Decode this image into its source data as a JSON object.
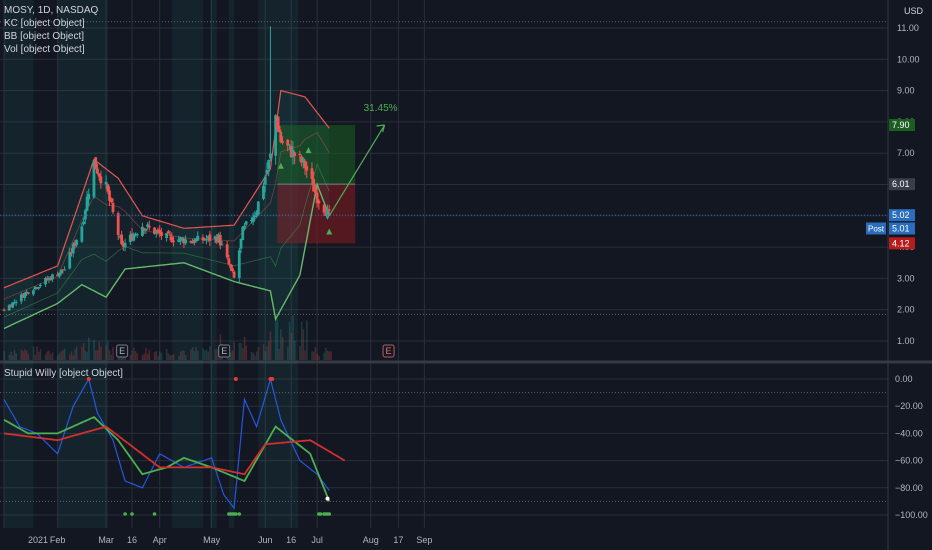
{
  "header": {
    "symbol_line": "MOSY, 1D, NASDAQ",
    "currency": "USD"
  },
  "legend": {
    "kc": "KC [object Object]",
    "bb": "BB [object Object]",
    "vol": "Vol [object Object]",
    "oscillator": "Stupid Willy [object Object]"
  },
  "colors": {
    "background": "#131722",
    "grid": "#2a2e39",
    "up": "#26a69a",
    "down": "#ef5350",
    "kc_band": "#ef5350",
    "bb_band": "#4caf50",
    "long_target": "#1b5e20",
    "long_stop": "#801922",
    "signal_red": "#d32f2f",
    "signal_green": "#4caf50",
    "osc_blue": "#2962ff",
    "accent_teal": "#26a69a"
  },
  "position_tool": {
    "percent_label": "31.45%",
    "target": 7.9,
    "entry": 6.01,
    "stop": 4.12
  },
  "price_tags": [
    {
      "value": 7.9,
      "text": "7.90",
      "color": "#1b5e20"
    },
    {
      "value": 6.01,
      "text": "6.01",
      "color": "#3a3e4a"
    },
    {
      "value": 5.02,
      "text": "5.02",
      "color": "#2a6dbd"
    },
    {
      "value": 5.01,
      "text": "Post · 5.01",
      "color": "#2a6dbd"
    },
    {
      "value": 4.12,
      "text": "4.12",
      "color": "#b71c1c"
    }
  ],
  "earnings_markers": [
    "E",
    "E",
    "E"
  ],
  "chart_data": [
    {
      "type": "candlestick",
      "title": "MOSY, 1D, NASDAQ",
      "y_axis": {
        "ticks": [
          1.0,
          2.0,
          3.0,
          4.0,
          5.0,
          6.0,
          7.0,
          8.0,
          9.0,
          10.0,
          11.0
        ],
        "labels": [
          "1.00",
          "2.00",
          "3.00",
          "4.00",
          "5.00",
          "6.00",
          "7.00",
          "8.00",
          "9.00",
          "10.00",
          "11.00"
        ],
        "ylim": [
          0.5,
          11.6
        ],
        "currency": "USD"
      },
      "x_axis": {
        "labels": [
          "2021",
          "Feb",
          "Mar",
          "16",
          "Apr",
          "May",
          "Jun",
          "16",
          "Jul",
          "Aug",
          "17",
          "Sep"
        ]
      },
      "close_anchors": [
        {
          "date": "2021-01-01",
          "price": 2.0
        },
        {
          "date": "2021-01-15",
          "price": 2.6
        },
        {
          "date": "2021-02-05",
          "price": 3.3
        },
        {
          "date": "2021-02-15",
          "price": 4.7
        },
        {
          "date": "2021-02-22",
          "price": 6.7
        },
        {
          "date": "2021-03-01",
          "price": 5.9
        },
        {
          "date": "2021-03-10",
          "price": 4.0
        },
        {
          "date": "2021-03-22",
          "price": 4.7
        },
        {
          "date": "2021-04-05",
          "price": 4.3
        },
        {
          "date": "2021-04-20",
          "price": 4.2
        },
        {
          "date": "2021-05-05",
          "price": 4.3
        },
        {
          "date": "2021-05-14",
          "price": 3.0
        },
        {
          "date": "2021-05-19",
          "price": 4.5
        },
        {
          "date": "2021-05-27",
          "price": 5.2
        },
        {
          "date": "2021-06-04",
          "price": 6.9
        },
        {
          "date": "2021-06-07",
          "price": 8.2
        },
        {
          "date": "2021-06-10",
          "price": 7.4
        },
        {
          "date": "2021-06-17",
          "price": 7.0
        },
        {
          "date": "2021-06-24",
          "price": 6.6
        },
        {
          "date": "2021-07-01",
          "price": 5.6
        },
        {
          "date": "2021-07-08",
          "price": 5.0
        }
      ],
      "spike_high": {
        "date": "2021-06-04",
        "price": 10.8
      },
      "bb_lower": [
        {
          "date": "2021-01-01",
          "price": 1.4
        },
        {
          "date": "2021-02-01",
          "price": 2.2
        },
        {
          "date": "2021-02-15",
          "price": 2.8
        },
        {
          "date": "2021-03-01",
          "price": 2.4
        },
        {
          "date": "2021-03-12",
          "price": 3.3
        },
        {
          "date": "2021-04-15",
          "price": 3.5
        },
        {
          "date": "2021-05-14",
          "price": 2.9
        },
        {
          "date": "2021-06-04",
          "price": 2.6
        },
        {
          "date": "2021-06-07",
          "price": 1.7
        },
        {
          "date": "2021-06-21",
          "price": 3.1
        },
        {
          "date": "2021-07-01",
          "price": 6.0
        },
        {
          "date": "2021-07-08",
          "price": 5.0
        }
      ],
      "kc_upper": [
        {
          "date": "2021-01-01",
          "price": 2.7
        },
        {
          "date": "2021-02-01",
          "price": 3.4
        },
        {
          "date": "2021-02-22",
          "price": 6.8
        },
        {
          "date": "2021-03-08",
          "price": 6.2
        },
        {
          "date": "2021-03-22",
          "price": 5.0
        },
        {
          "date": "2021-04-15",
          "price": 4.6
        },
        {
          "date": "2021-05-14",
          "price": 4.7
        },
        {
          "date": "2021-06-04",
          "price": 6.5
        },
        {
          "date": "2021-06-10",
          "price": 9.0
        },
        {
          "date": "2021-06-24",
          "price": 8.8
        },
        {
          "date": "2021-07-08",
          "price": 7.8
        }
      ],
      "position": {
        "start": "2021-06-08",
        "end": "2021-07-23",
        "target": 7.9,
        "entry": 6.01,
        "stop": 4.12,
        "arrow_to": {
          "date": "2021-08-09",
          "price": 7.9
        }
      }
    },
    {
      "type": "line",
      "title": "Stupid Willy [object Object]",
      "y_axis": {
        "ticks": [
          0,
          -20,
          -40,
          -60,
          -80,
          -100
        ],
        "labels": [
          "0.00",
          "−20.00",
          "−40.00",
          "−60.00",
          "−80.00",
          "−100.00"
        ],
        "ylim": [
          -105,
          3
        ]
      },
      "series": [
        {
          "color": "#2962ff",
          "points": [
            {
              "date": "2021-01-01",
              "value": -15
            },
            {
              "date": "2021-01-10",
              "value": -35
            },
            {
              "date": "2021-01-20",
              "value": -40
            },
            {
              "date": "2021-02-01",
              "value": -55
            },
            {
              "date": "2021-02-10",
              "value": -20
            },
            {
              "date": "2021-02-19",
              "value": 0
            },
            {
              "date": "2021-02-24",
              "value": -25
            },
            {
              "date": "2021-03-05",
              "value": -45
            },
            {
              "date": "2021-03-12",
              "value": -75
            },
            {
              "date": "2021-03-22",
              "value": -80
            },
            {
              "date": "2021-04-01",
              "value": -55
            },
            {
              "date": "2021-04-15",
              "value": -65
            },
            {
              "date": "2021-05-01",
              "value": -58
            },
            {
              "date": "2021-05-08",
              "value": -85
            },
            {
              "date": "2021-05-14",
              "value": -95
            },
            {
              "date": "2021-05-20",
              "value": -15
            },
            {
              "date": "2021-05-27",
              "value": -35
            },
            {
              "date": "2021-06-04",
              "value": 0
            },
            {
              "date": "2021-06-10",
              "value": -30
            },
            {
              "date": "2021-06-21",
              "value": -60
            },
            {
              "date": "2021-07-01",
              "value": -70
            },
            {
              "date": "2021-07-08",
              "value": -82
            }
          ]
        },
        {
          "color": "#4caf50",
          "points": [
            {
              "date": "2021-01-01",
              "value": -30
            },
            {
              "date": "2021-01-15",
              "value": -40
            },
            {
              "date": "2021-02-01",
              "value": -40
            },
            {
              "date": "2021-02-22",
              "value": -28
            },
            {
              "date": "2021-03-08",
              "value": -45
            },
            {
              "date": "2021-03-22",
              "value": -70
            },
            {
              "date": "2021-04-05",
              "value": -65
            },
            {
              "date": "2021-04-15",
              "value": -58
            },
            {
              "date": "2021-05-01",
              "value": -65
            },
            {
              "date": "2021-05-20",
              "value": -75
            },
            {
              "date": "2021-06-07",
              "value": -35
            },
            {
              "date": "2021-06-17",
              "value": -45
            },
            {
              "date": "2021-06-27",
              "value": -55
            },
            {
              "date": "2021-07-08",
              "value": -90
            }
          ]
        },
        {
          "color": "#d32f2f",
          "points": [
            {
              "date": "2021-01-01",
              "value": -40
            },
            {
              "date": "2021-02-01",
              "value": -45
            },
            {
              "date": "2021-03-01",
              "value": -35
            },
            {
              "date": "2021-04-01",
              "value": -65
            },
            {
              "date": "2021-05-01",
              "value": -65
            },
            {
              "date": "2021-05-20",
              "value": -70
            },
            {
              "date": "2021-06-01",
              "value": -48
            },
            {
              "date": "2021-06-27",
              "value": -45
            },
            {
              "date": "2021-07-17",
              "value": -60
            }
          ]
        }
      ]
    }
  ]
}
